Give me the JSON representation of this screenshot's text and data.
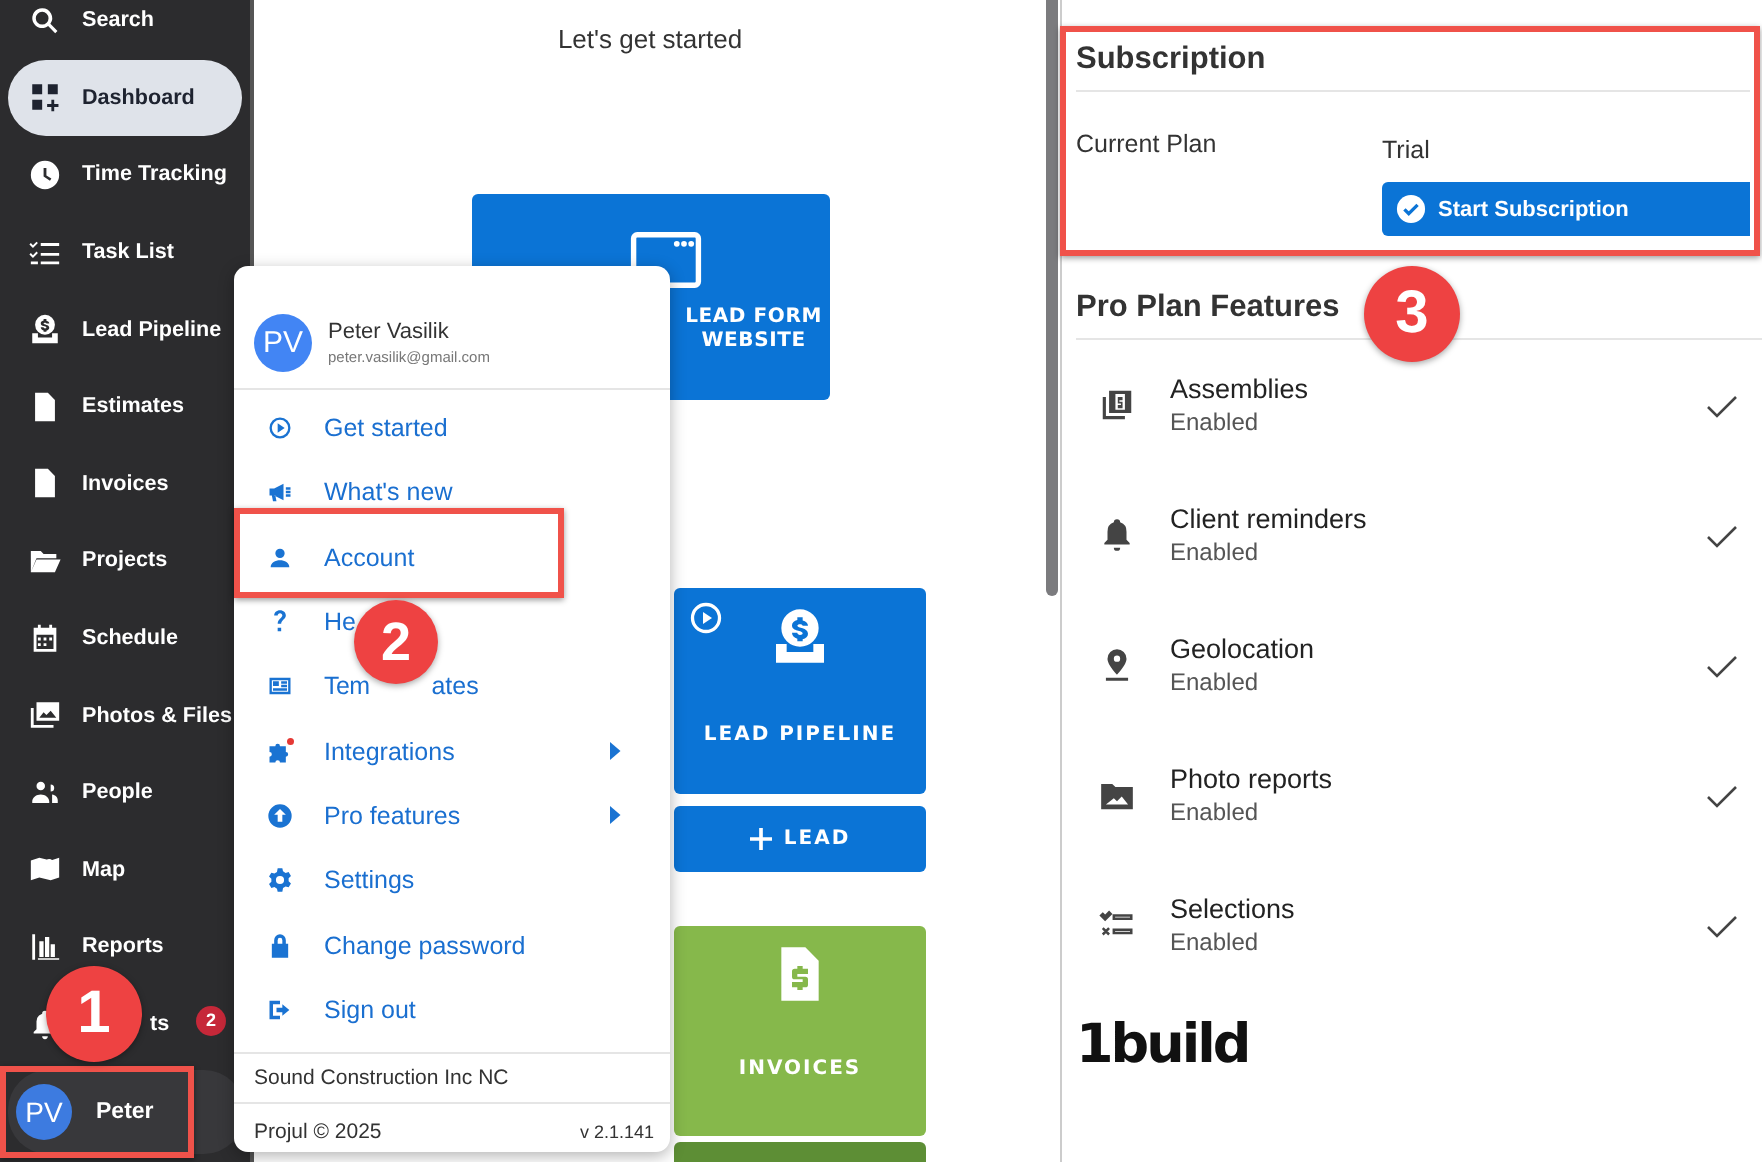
{
  "sidebar": {
    "items": [
      {
        "label": "Search",
        "selected": false
      },
      {
        "label": "Dashboard",
        "selected": true
      },
      {
        "label": "Time Tracking",
        "selected": false
      },
      {
        "label": "Task List",
        "selected": false
      },
      {
        "label": "Lead Pipeline",
        "selected": false
      },
      {
        "label": "Estimates",
        "selected": false
      },
      {
        "label": "Invoices",
        "selected": false
      },
      {
        "label": "Projects",
        "selected": false
      },
      {
        "label": "Schedule",
        "selected": false
      },
      {
        "label": "Photos & Files",
        "selected": false
      },
      {
        "label": "People",
        "selected": false
      },
      {
        "label": "Map",
        "selected": false
      },
      {
        "label": "Reports",
        "selected": false
      },
      {
        "label": "ts",
        "selected": false,
        "badge": "2"
      }
    ],
    "user": {
      "initials": "PV",
      "name": "Peter"
    }
  },
  "main": {
    "heading": "Let's get started",
    "tiles": [
      {
        "kind": "lead_form",
        "color": "#0b74d6",
        "lines": [
          "LEAD FORM",
          "WEBSITE"
        ]
      },
      {
        "kind": "pipeline",
        "color": "#0b74d6",
        "lines": [
          "LEAD PIPELINE"
        ],
        "action": "LEAD"
      },
      {
        "kind": "invoices",
        "color": "#86b84b",
        "lines": [
          "INVOICES"
        ]
      }
    ]
  },
  "menu": {
    "initials": "PV",
    "name": "Peter Vasilik",
    "email": "peter.vasilik@gmail.com",
    "items": [
      {
        "label": "Get started",
        "has_new": false,
        "submenu": false
      },
      {
        "label": "What's new",
        "has_new": false,
        "submenu": false
      },
      {
        "label": "Account",
        "has_new": false,
        "submenu": false
      },
      {
        "label": "He",
        "has_new": false,
        "submenu": false
      },
      {
        "label": "Tem",
        "tail": "ates",
        "has_new": false,
        "submenu": false
      },
      {
        "label": "Integrations",
        "has_new": true,
        "submenu": true
      },
      {
        "label": "Pro features",
        "has_new": false,
        "submenu": true
      },
      {
        "label": "Settings",
        "has_new": false,
        "submenu": false
      },
      {
        "label": "Change password",
        "has_new": false,
        "submenu": false
      },
      {
        "label": "Sign out",
        "has_new": false,
        "submenu": false
      }
    ],
    "company": "Sound Construction Inc NC",
    "copyright": "Projul © 2025",
    "version": "v 2.1.141"
  },
  "subscription": {
    "title": "Subscription",
    "plan_label": "Current Plan",
    "plan_value": "Trial",
    "button": "Start Subscription"
  },
  "features": {
    "title": "Pro Plan Features",
    "items": [
      {
        "name": "Assemblies",
        "status": "Enabled",
        "enabled": true
      },
      {
        "name": "Client reminders",
        "status": "Enabled",
        "enabled": true
      },
      {
        "name": "Geolocation",
        "status": "Enabled",
        "enabled": true
      },
      {
        "name": "Photo reports",
        "status": "Enabled",
        "enabled": true
      },
      {
        "name": "Selections",
        "status": "Enabled",
        "enabled": true
      }
    ]
  },
  "logo": "1build",
  "annotations": [
    {
      "number": "1"
    },
    {
      "number": "2"
    },
    {
      "number": "3"
    }
  ]
}
